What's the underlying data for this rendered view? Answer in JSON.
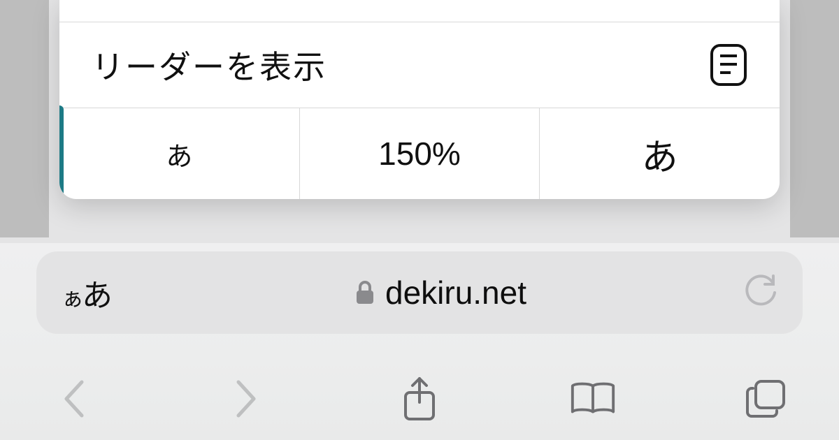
{
  "popover": {
    "reader_label": "リーダーを表示",
    "zoom_small_glyph": "あ",
    "zoom_value": "150%",
    "zoom_large_glyph": "あ"
  },
  "addressbar": {
    "aa_small": "ぁ",
    "aa_large": "あ",
    "domain": "dekiru.net"
  },
  "colors": {
    "teal_accent": "#1d7a85",
    "icon_grey": "#6f6f72"
  }
}
